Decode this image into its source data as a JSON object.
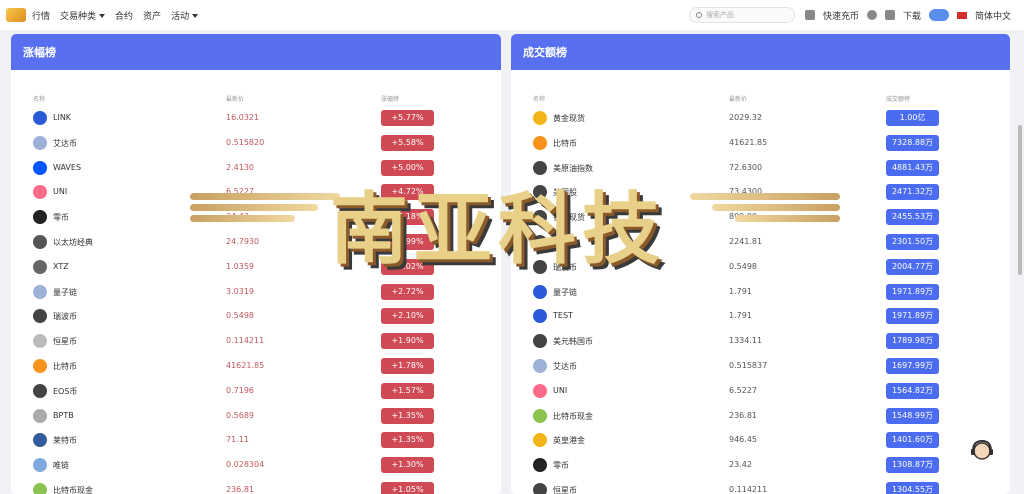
{
  "nav": {
    "items": [
      {
        "label": "行情",
        "caret": false
      },
      {
        "label": "交易种类",
        "caret": true
      },
      {
        "label": "合约",
        "caret": false
      },
      {
        "label": "资产",
        "caret": false
      },
      {
        "label": "活动",
        "caret": true
      }
    ]
  },
  "search": {
    "placeholder": "搜索产品"
  },
  "tools": {
    "quick": "快速充币",
    "download": "下载",
    "language": "简体中文"
  },
  "gainers": {
    "title": "涨幅榜",
    "col_name": "名称",
    "col_price": "最新价",
    "col_change": "涨幅榜",
    "rows": [
      {
        "name": "LINK",
        "price": "16.0321",
        "change": "+5.77%",
        "icon": "chainlink-icon",
        "color": "#2a5ada"
      },
      {
        "name": "艾达币",
        "price": "0.515820",
        "change": "+5.58%",
        "icon": "cardano-icon",
        "color": "#9fb0d8"
      },
      {
        "name": "WAVES",
        "price": "2.4130",
        "change": "+5.00%",
        "icon": "waves-icon",
        "color": "#0055ff"
      },
      {
        "name": "UNI",
        "price": "6.5227",
        "change": "+4.72%",
        "icon": "uniswap-icon",
        "color": "#ff6a88"
      },
      {
        "name": "零币",
        "price": "24.43",
        "change": "+4.18%",
        "icon": "zcash-icon",
        "color": "#222222"
      },
      {
        "name": "以太坊经典",
        "price": "24.7930",
        "change": "+3.99%",
        "icon": "ethereum-classic-icon",
        "color": "#555555"
      },
      {
        "name": "XTZ",
        "price": "1.0359",
        "change": "+3.02%",
        "icon": "tezos-icon",
        "color": "#666666"
      },
      {
        "name": "量子链",
        "price": "3.0319",
        "change": "+2.72%",
        "icon": "qtum-icon",
        "color": "#9fb0d8"
      },
      {
        "name": "瑞波币",
        "price": "0.5498",
        "change": "+2.10%",
        "icon": "ripple-icon",
        "color": "#444444"
      },
      {
        "name": "恒星币",
        "price": "0.114211",
        "change": "+1.90%",
        "icon": "stellar-icon",
        "color": "#bbbbbb"
      },
      {
        "name": "比特币",
        "price": "41621.85",
        "change": "+1.78%",
        "icon": "bitcoin-icon",
        "color": "#f7931a"
      },
      {
        "name": "EOS币",
        "price": "0.7196",
        "change": "+1.57%",
        "icon": "eos-icon",
        "color": "#444444"
      },
      {
        "name": "BPTB",
        "price": "0.5689",
        "change": "+1.35%",
        "icon": "bptb-icon",
        "color": "#aaaaaa"
      },
      {
        "name": "莱特币",
        "price": "71.11",
        "change": "+1.35%",
        "icon": "litecoin-icon",
        "color": "#345d9d"
      },
      {
        "name": "唯链",
        "price": "0.028304",
        "change": "+1.30%",
        "icon": "vechain-icon",
        "color": "#82a8e0"
      },
      {
        "name": "比特币现金",
        "price": "236.81",
        "change": "+1.05%",
        "icon": "bitcoin-cash-icon",
        "color": "#8dc351"
      }
    ]
  },
  "volume": {
    "title": "成交额榜",
    "col_name": "名称",
    "col_price": "最新价",
    "col_volume": "成交额榜",
    "rows": [
      {
        "name": "黄金现货",
        "price": "2029.32",
        "volume": "1.00亿",
        "icon": "gold-icon",
        "color": "#f2b61c"
      },
      {
        "name": "比特币",
        "price": "41621.85",
        "volume": "7328.88万",
        "icon": "bitcoin-icon",
        "color": "#f7931a"
      },
      {
        "name": "美原油指数",
        "price": "72.6300",
        "volume": "4881.43万",
        "icon": "coins-icon",
        "color": "#444444"
      },
      {
        "name": "美国股",
        "price": "73.4300",
        "volume": "2471.32万",
        "icon": "coins-icon",
        "color": "#444444"
      },
      {
        "name": "铂金现货",
        "price": "899.00",
        "volume": "2455.53万",
        "icon": "coins-icon",
        "color": "#444444"
      },
      {
        "name": "以太坊",
        "price": "2241.81",
        "volume": "2301.50万",
        "icon": "coins-icon",
        "color": "#444444"
      },
      {
        "name": "瑞波币",
        "price": "0.5498",
        "volume": "2004.77万",
        "icon": "coins-icon",
        "color": "#444444"
      },
      {
        "name": "量子链",
        "price": "1.791",
        "volume": "1971.89万",
        "icon": "huobi-icon",
        "color": "#2a5ada"
      },
      {
        "name": "TEST",
        "price": "1.791",
        "volume": "1971.89万",
        "icon": "huobi-icon",
        "color": "#2a5ada"
      },
      {
        "name": "美元韩国币",
        "price": "1334.11",
        "volume": "1789.98万",
        "icon": "coins-icon",
        "color": "#444444"
      },
      {
        "name": "艾达币",
        "price": "0.515837",
        "volume": "1697.99万",
        "icon": "cardano-icon",
        "color": "#9fb0d8"
      },
      {
        "name": "UNI",
        "price": "6.5227",
        "volume": "1564.82万",
        "icon": "uniswap-icon",
        "color": "#ff6a88"
      },
      {
        "name": "比特币现金",
        "price": "236.81",
        "volume": "1548.99万",
        "icon": "bitcoin-cash-icon",
        "color": "#8dc351"
      },
      {
        "name": "英皇港金",
        "price": "946.45",
        "volume": "1401.60万",
        "icon": "gold-icon",
        "color": "#f2b61c"
      },
      {
        "name": "零币",
        "price": "23.42",
        "volume": "1308.87万",
        "icon": "zcash-icon",
        "color": "#222222"
      },
      {
        "name": "恒星币",
        "price": "0.114211",
        "volume": "1304.55万",
        "icon": "coins-icon",
        "color": "#444444"
      }
    ]
  },
  "watermark": {
    "text": "南亚科技"
  }
}
